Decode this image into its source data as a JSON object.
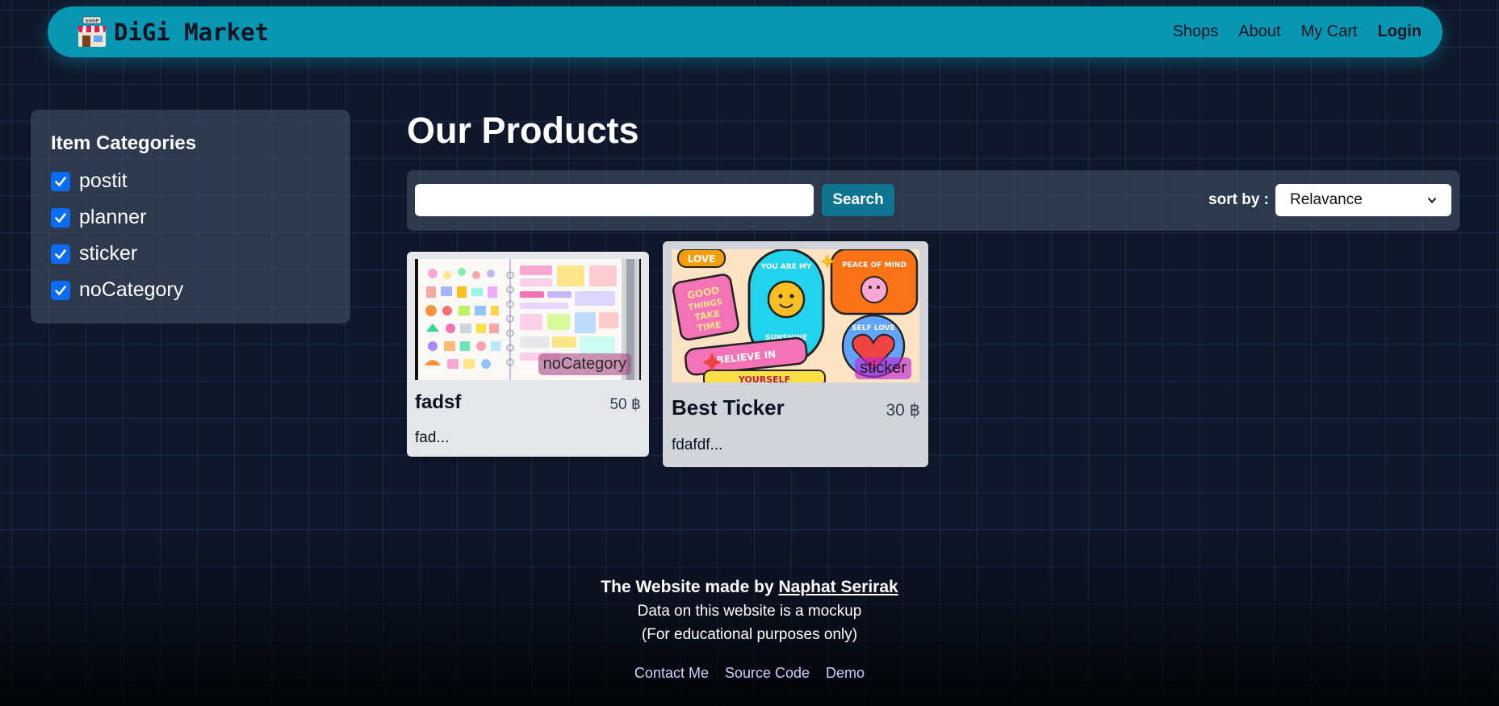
{
  "navbar": {
    "brand": "DiGi Market",
    "brand_icon": "shop-icon",
    "shop_sign": "SHOP",
    "links": [
      "Shops",
      "About",
      "My Cart",
      "Login"
    ]
  },
  "sidebar": {
    "title": "Item Categories",
    "categories": [
      {
        "label": "postit",
        "checked": true
      },
      {
        "label": "planner",
        "checked": true
      },
      {
        "label": "sticker",
        "checked": true
      },
      {
        "label": "noCategory",
        "checked": true
      }
    ]
  },
  "main": {
    "title": "Our Products",
    "search": {
      "value": "",
      "placeholder": "",
      "button": "Search"
    },
    "sort": {
      "label": "sort by :",
      "selected": "Relavance"
    }
  },
  "products": [
    {
      "name": "fadsf",
      "price": "50 ฿",
      "desc": "fad...",
      "tag": "noCategory",
      "image": "planner-stickers-image"
    },
    {
      "name": "Best Ticker",
      "price": "30 ฿",
      "desc": "fdafdf...",
      "tag": "sticker",
      "image": "retro-stickers-image"
    }
  ],
  "sticker_art": {
    "love": "LOVE",
    "good": "GOOD",
    "things": "THINGS",
    "take": "TAKE",
    "time": "TIME",
    "you_are_my": "YOU ARE MY",
    "sunshine": "SUNSHINE",
    "peace_of_mind": "PEACE OF MIND",
    "believe_in": "BELIEVE IN",
    "yourself": "YOURSELF",
    "self_love": "SELF LOVE"
  },
  "footer": {
    "made_by_prefix": "The Website made by ",
    "author": "Naphat Serirak",
    "line2": "Data on this website is a mockup",
    "line3": "(For educational purposes only)",
    "links": [
      "Contact Me",
      "Source Code",
      "Demo"
    ]
  },
  "colors": {
    "navbar": "#0797b3",
    "background": "#0f172a",
    "search_button": "#0e7490",
    "checkbox": "#0a6cf0"
  }
}
